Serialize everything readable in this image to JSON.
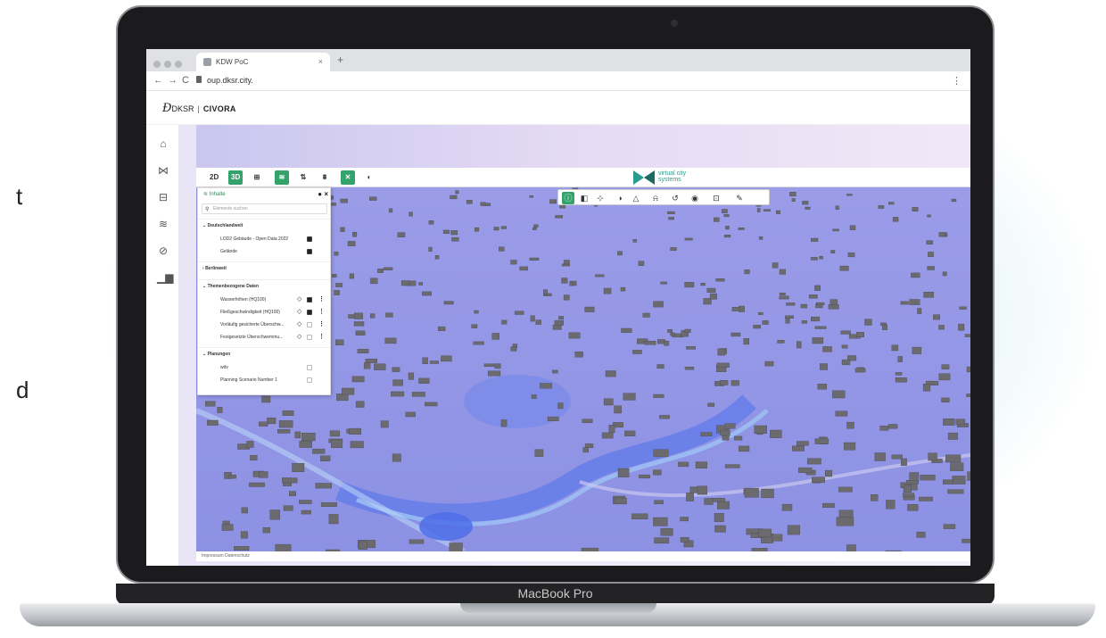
{
  "laptop": {
    "brand_label": "MacBook Pro"
  },
  "browser": {
    "tab_title": "KDW PoC",
    "tab_close": "×",
    "new_tab": "+",
    "back": "←",
    "forward": "→",
    "reload": "C",
    "url": "oup.dksr.city.",
    "menu": "⋮"
  },
  "app": {
    "logo_mark": "Ð",
    "logo_text": "DKSR",
    "logo_separator": "|",
    "logo_product": "CIVORA",
    "nav_icons": [
      "home-icon",
      "viewer-icon",
      "layout-icon",
      "layers-icon",
      "compass-icon",
      "analytics-icon"
    ]
  },
  "viewer": {
    "toolbar": {
      "mode_2d": "2D",
      "mode_3d": "3D",
      "active_mode": "3D"
    },
    "vendor": {
      "line1": "virtual city",
      "line2": "systems"
    },
    "attribution": "Impressum  Datenschutz"
  },
  "panel": {
    "title": "Inhalte",
    "close": "×",
    "search_placeholder": "Elemente suchen",
    "groups": [
      {
        "label": "Deutschlandweit",
        "expanded": true,
        "items": [
          {
            "label": "LOD2 Gebäude - Open Data 2022",
            "checked": true,
            "style": false,
            "menu": false
          },
          {
            "label": "Gelände",
            "checked": true,
            "style": false,
            "menu": false
          }
        ]
      },
      {
        "label": "Berlinweit",
        "expanded": false,
        "items": []
      },
      {
        "label": "Themenbezogene Daten",
        "expanded": true,
        "items": [
          {
            "label": "Wasserhöhen (HQ100)",
            "checked": true,
            "style": true,
            "menu": true
          },
          {
            "label": "Fließgeschwindigkeit (HQ100)",
            "checked": true,
            "style": true,
            "menu": true
          },
          {
            "label": "Vorläufig gesicherte Überschw...",
            "checked": false,
            "style": true,
            "menu": true
          },
          {
            "label": "Festgesetzte Überschwemmu...",
            "checked": false,
            "style": true,
            "menu": true
          }
        ]
      },
      {
        "label": "Planungen",
        "expanded": true,
        "items": [
          {
            "label": "wdv",
            "checked": false,
            "style": false,
            "menu": false
          },
          {
            "label": "Planning Scenario Number 1",
            "checked": false,
            "style": false,
            "menu": false
          }
        ]
      }
    ]
  },
  "colors": {
    "accent_green": "#34a36b",
    "map_water": "#8f93e4",
    "building": "#6b6b6f"
  },
  "side_text": [
    "t",
    "d"
  ]
}
